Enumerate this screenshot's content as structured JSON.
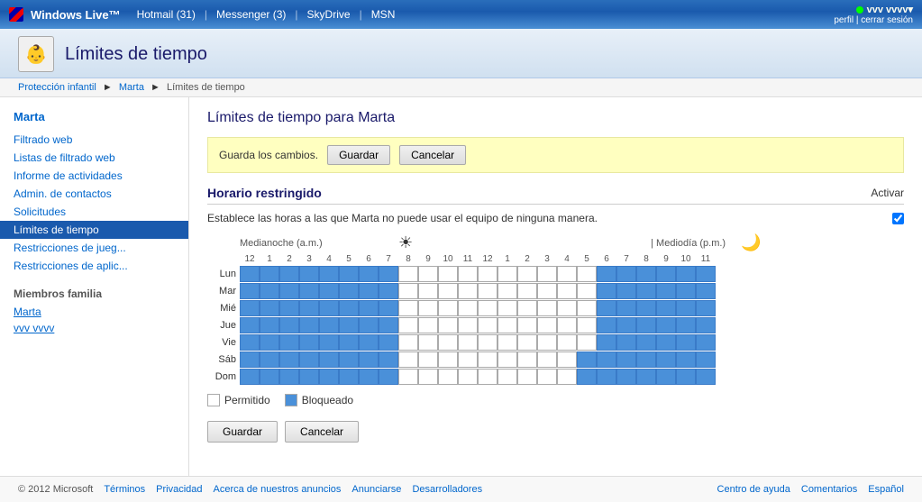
{
  "topbar": {
    "logo_text": "Windows Live™",
    "nav_items": [
      {
        "label": "Hotmail (31)",
        "key": "hotmail"
      },
      {
        "label": "Messenger (3)",
        "key": "messenger"
      },
      {
        "label": "SkyDrive",
        "key": "skydrive"
      },
      {
        "label": "MSN",
        "key": "msn"
      }
    ],
    "username": "vvv vvvv▾",
    "user_links": "perfil | cerrar sesión"
  },
  "page_header": {
    "title": "Límites de tiempo",
    "icon": "⏱"
  },
  "breadcrumb": {
    "items": [
      "Protección infantil",
      "Marta",
      "Límites de tiempo"
    ]
  },
  "sidebar": {
    "current_user": "Marta",
    "nav_items": [
      {
        "label": "Filtrado web",
        "key": "filtrado-web",
        "active": false
      },
      {
        "label": "Listas de filtrado web",
        "key": "listas-filtrado",
        "active": false
      },
      {
        "label": "Informe de actividades",
        "key": "informe",
        "active": false
      },
      {
        "label": "Admin. de contactos",
        "key": "admin-contactos",
        "active": false
      },
      {
        "label": "Solicitudes",
        "key": "solicitudes",
        "active": false
      },
      {
        "label": "Límites de tiempo",
        "key": "limites-tiempo",
        "active": true
      },
      {
        "label": "Restricciones de jueg...",
        "key": "restricciones-jueg",
        "active": false
      },
      {
        "label": "Restricciones de aplic...",
        "key": "restricciones-aplic",
        "active": false
      }
    ],
    "section_title": "Miembros familia",
    "members": [
      {
        "label": "Marta",
        "key": "marta"
      },
      {
        "label": "vvv vvvv",
        "key": "vvv-vvvv"
      }
    ]
  },
  "content": {
    "title": "Límites de tiempo para Marta",
    "save_banner_text": "Guarda los cambios.",
    "save_label": "Guardar",
    "cancel_label": "Cancelar",
    "schedule_title": "Horario restringido",
    "activate_label": "Activar",
    "description": "Establece las horas a las que Marta no puede usar el equipo de ninguna manera.",
    "checkbox_checked": true,
    "period_am": "Medianoche (a.m.)",
    "period_pm": "| Mediodía (p.m.)",
    "hour_labels": [
      "12",
      "1",
      "2",
      "3",
      "4",
      "5",
      "6",
      "7",
      "8",
      "9",
      "10",
      "11",
      "12",
      "1",
      "2",
      "3",
      "4",
      "5",
      "6",
      "7",
      "8",
      "9",
      "10",
      "11"
    ],
    "days": [
      "Lun",
      "Mar",
      "Mié",
      "Jue",
      "Vie",
      "Sáb",
      "Dom"
    ],
    "legend_allowed": "Permitido",
    "legend_blocked": "Bloqueado",
    "bottom_save": "Guardar",
    "bottom_cancel": "Cancelar",
    "grid": {
      "Lun": [
        1,
        1,
        1,
        1,
        1,
        1,
        1,
        1,
        0,
        0,
        0,
        0,
        0,
        0,
        0,
        0,
        0,
        0,
        1,
        1,
        1,
        1,
        1,
        1
      ],
      "Mar": [
        1,
        1,
        1,
        1,
        1,
        1,
        1,
        1,
        0,
        0,
        0,
        0,
        0,
        0,
        0,
        0,
        0,
        0,
        1,
        1,
        1,
        1,
        1,
        1
      ],
      "Mié": [
        1,
        1,
        1,
        1,
        1,
        1,
        1,
        1,
        0,
        0,
        0,
        0,
        0,
        0,
        0,
        0,
        0,
        0,
        1,
        1,
        1,
        1,
        1,
        1
      ],
      "Jue": [
        1,
        1,
        1,
        1,
        1,
        1,
        1,
        1,
        0,
        0,
        0,
        0,
        0,
        0,
        0,
        0,
        0,
        0,
        1,
        1,
        1,
        1,
        1,
        1
      ],
      "Vie": [
        1,
        1,
        1,
        1,
        1,
        1,
        1,
        1,
        0,
        0,
        0,
        0,
        0,
        0,
        0,
        0,
        0,
        0,
        1,
        1,
        1,
        1,
        1,
        1
      ],
      "Sáb": [
        1,
        1,
        1,
        1,
        1,
        1,
        1,
        1,
        0,
        0,
        0,
        0,
        0,
        0,
        0,
        0,
        0,
        1,
        1,
        1,
        1,
        1,
        1,
        1
      ],
      "Dom": [
        1,
        1,
        1,
        1,
        1,
        1,
        1,
        1,
        0,
        0,
        0,
        0,
        0,
        0,
        0,
        0,
        0,
        1,
        1,
        1,
        1,
        1,
        1,
        1
      ]
    }
  },
  "footer": {
    "left_items": [
      "© 2012 Microsoft",
      "Términos",
      "Privacidad",
      "Acerca de nuestros anuncios",
      "Anunciarse",
      "Desarrolladores"
    ],
    "right_items": [
      "Centro de ayuda",
      "Comentarios",
      "Español"
    ]
  }
}
